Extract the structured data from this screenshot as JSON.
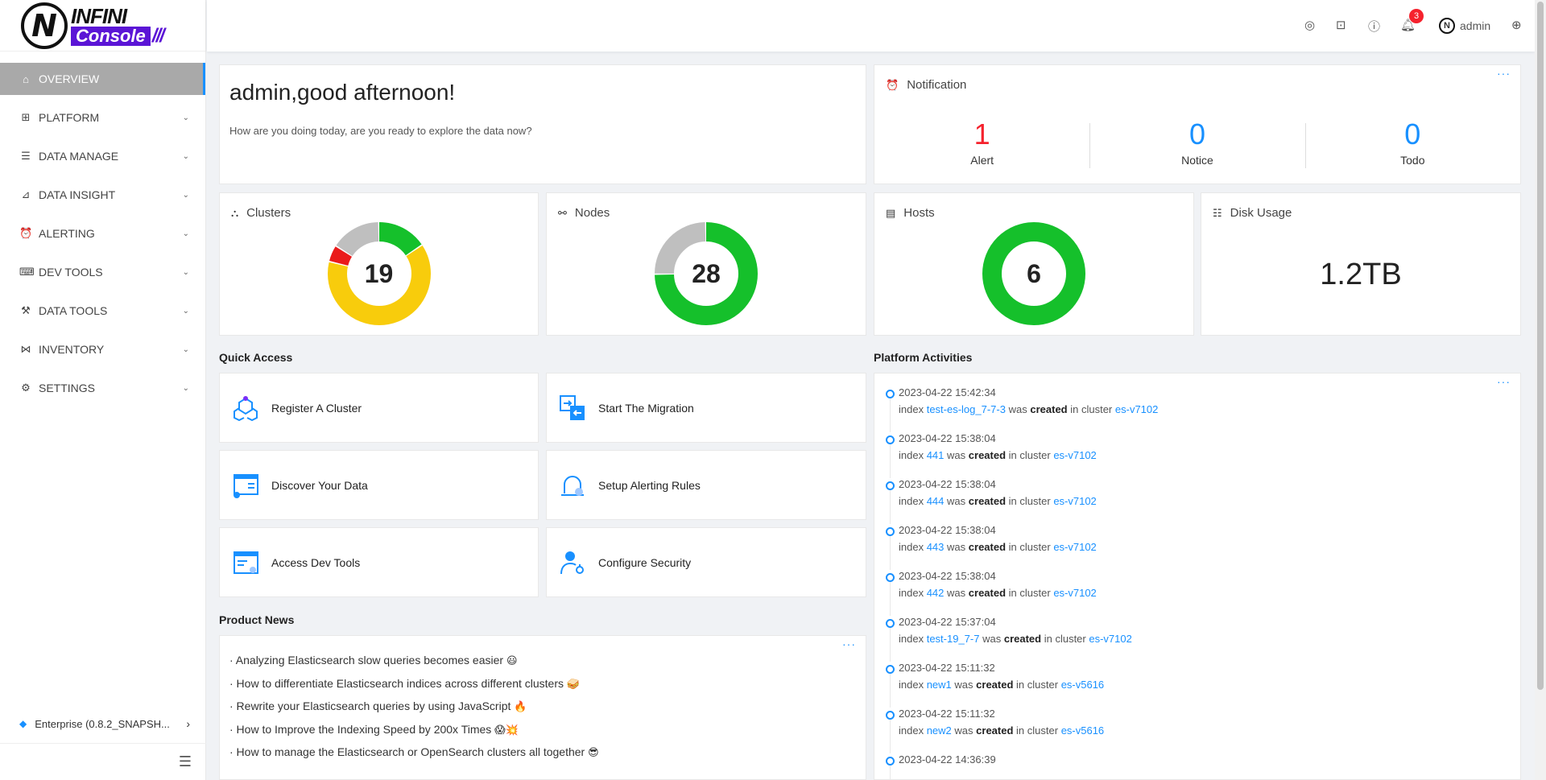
{
  "brand": {
    "top": "INFINI",
    "bottom": "Console",
    "mark": "N"
  },
  "sidebar": {
    "items": [
      {
        "label": "OVERVIEW",
        "icon": "home-icon",
        "glyph": "⌂"
      },
      {
        "label": "PLATFORM",
        "icon": "platform-icon",
        "glyph": "⊞"
      },
      {
        "label": "DATA MANAGE",
        "icon": "database-icon",
        "glyph": "☰"
      },
      {
        "label": "DATA INSIGHT",
        "icon": "chart-icon",
        "glyph": "⊿"
      },
      {
        "label": "ALERTING",
        "icon": "alarm-icon",
        "glyph": "⏰"
      },
      {
        "label": "DEV TOOLS",
        "icon": "terminal-icon",
        "glyph": "⌨"
      },
      {
        "label": "DATA TOOLS",
        "icon": "tool-icon",
        "glyph": "⚒"
      },
      {
        "label": "INVENTORY",
        "icon": "share-icon",
        "glyph": "⋈"
      },
      {
        "label": "SETTINGS",
        "icon": "gear-icon",
        "glyph": "⚙"
      }
    ],
    "enterprise": "Enterprise (0.8.2_SNAPSH..."
  },
  "header": {
    "notification_count": "3",
    "user": "admin"
  },
  "welcome": {
    "greeting": "admin,good afternoon!",
    "subtitle": "How are you doing today, are you ready to explore the data now?"
  },
  "notification": {
    "title": "Notification",
    "items": [
      {
        "value": "1",
        "label": "Alert"
      },
      {
        "value": "0",
        "label": "Notice"
      },
      {
        "value": "0",
        "label": "Todo"
      }
    ]
  },
  "stats": {
    "clusters": {
      "title": "Clusters",
      "value": "19"
    },
    "nodes": {
      "title": "Nodes",
      "value": "28"
    },
    "hosts": {
      "title": "Hosts",
      "value": "6"
    },
    "disk": {
      "title": "Disk Usage",
      "value": "1.2TB"
    }
  },
  "chart_data": [
    {
      "type": "pie",
      "name": "",
      "total": 19,
      "slices": [
        {
          "color": "#15c02b",
          "value": 3
        },
        {
          "color": "#f8cc0c",
          "value": 12
        },
        {
          "color": "#ea1b1b",
          "value": 1
        },
        {
          "color": "#bfbfbf",
          "value": 3
        }
      ]
    },
    {
      "type": "pie",
      "name": "",
      "total": 28,
      "slices": [
        {
          "color": "#15c02b",
          "value": 21
        },
        {
          "color": "#bfbfbf",
          "value": 7
        }
      ]
    },
    {
      "type": "pie",
      "name": "",
      "total": 6,
      "slices": [
        {
          "color": "#15c02b",
          "value": 6
        }
      ]
    }
  ],
  "quick_access": {
    "title": "Quick Access",
    "items": [
      "Register A Cluster",
      "Start The Migration",
      "Discover Your Data",
      "Setup Alerting Rules",
      "Access Dev Tools",
      "Configure Security"
    ]
  },
  "news": {
    "title": "Product News",
    "items": [
      {
        "text": "· Analyzing Elasticsearch slow queries becomes easier",
        "emoji": "😃"
      },
      {
        "text": "· How to differentiate Elasticsearch indices across different clusters",
        "emoji": "🥪"
      },
      {
        "text": "· Rewrite your Elasticsearch queries by using JavaScript",
        "emoji": "🔥"
      },
      {
        "text": "· How to Improve the Indexing Speed by 200x Times",
        "emoji": "😱💥"
      },
      {
        "text": "· How to manage the Elasticsearch or OpenSearch clusters all together",
        "emoji": "😎"
      }
    ]
  },
  "activities": {
    "title": "Platform Activities",
    "items": [
      {
        "time": "2023-04-22 15:42:34",
        "index": "test-es-log_7-7-3",
        "cluster": "es-v7102"
      },
      {
        "time": "2023-04-22 15:38:04",
        "index": "441",
        "cluster": "es-v7102"
      },
      {
        "time": "2023-04-22 15:38:04",
        "index": "444",
        "cluster": "es-v7102"
      },
      {
        "time": "2023-04-22 15:38:04",
        "index": "443",
        "cluster": "es-v7102"
      },
      {
        "time": "2023-04-22 15:38:04",
        "index": "442",
        "cluster": "es-v7102"
      },
      {
        "time": "2023-04-22 15:37:04",
        "index": "test-19_7-7",
        "cluster": "es-v7102"
      },
      {
        "time": "2023-04-22 15:11:32",
        "index": "new1",
        "cluster": "es-v5616"
      },
      {
        "time": "2023-04-22 15:11:32",
        "index": "new2",
        "cluster": "es-v5616"
      },
      {
        "time": "2023-04-22 14:36:39",
        "index": "",
        "cluster": ""
      }
    ],
    "words": {
      "index": "index",
      "was": "was",
      "created": "created",
      "in_cluster": "in cluster"
    }
  }
}
